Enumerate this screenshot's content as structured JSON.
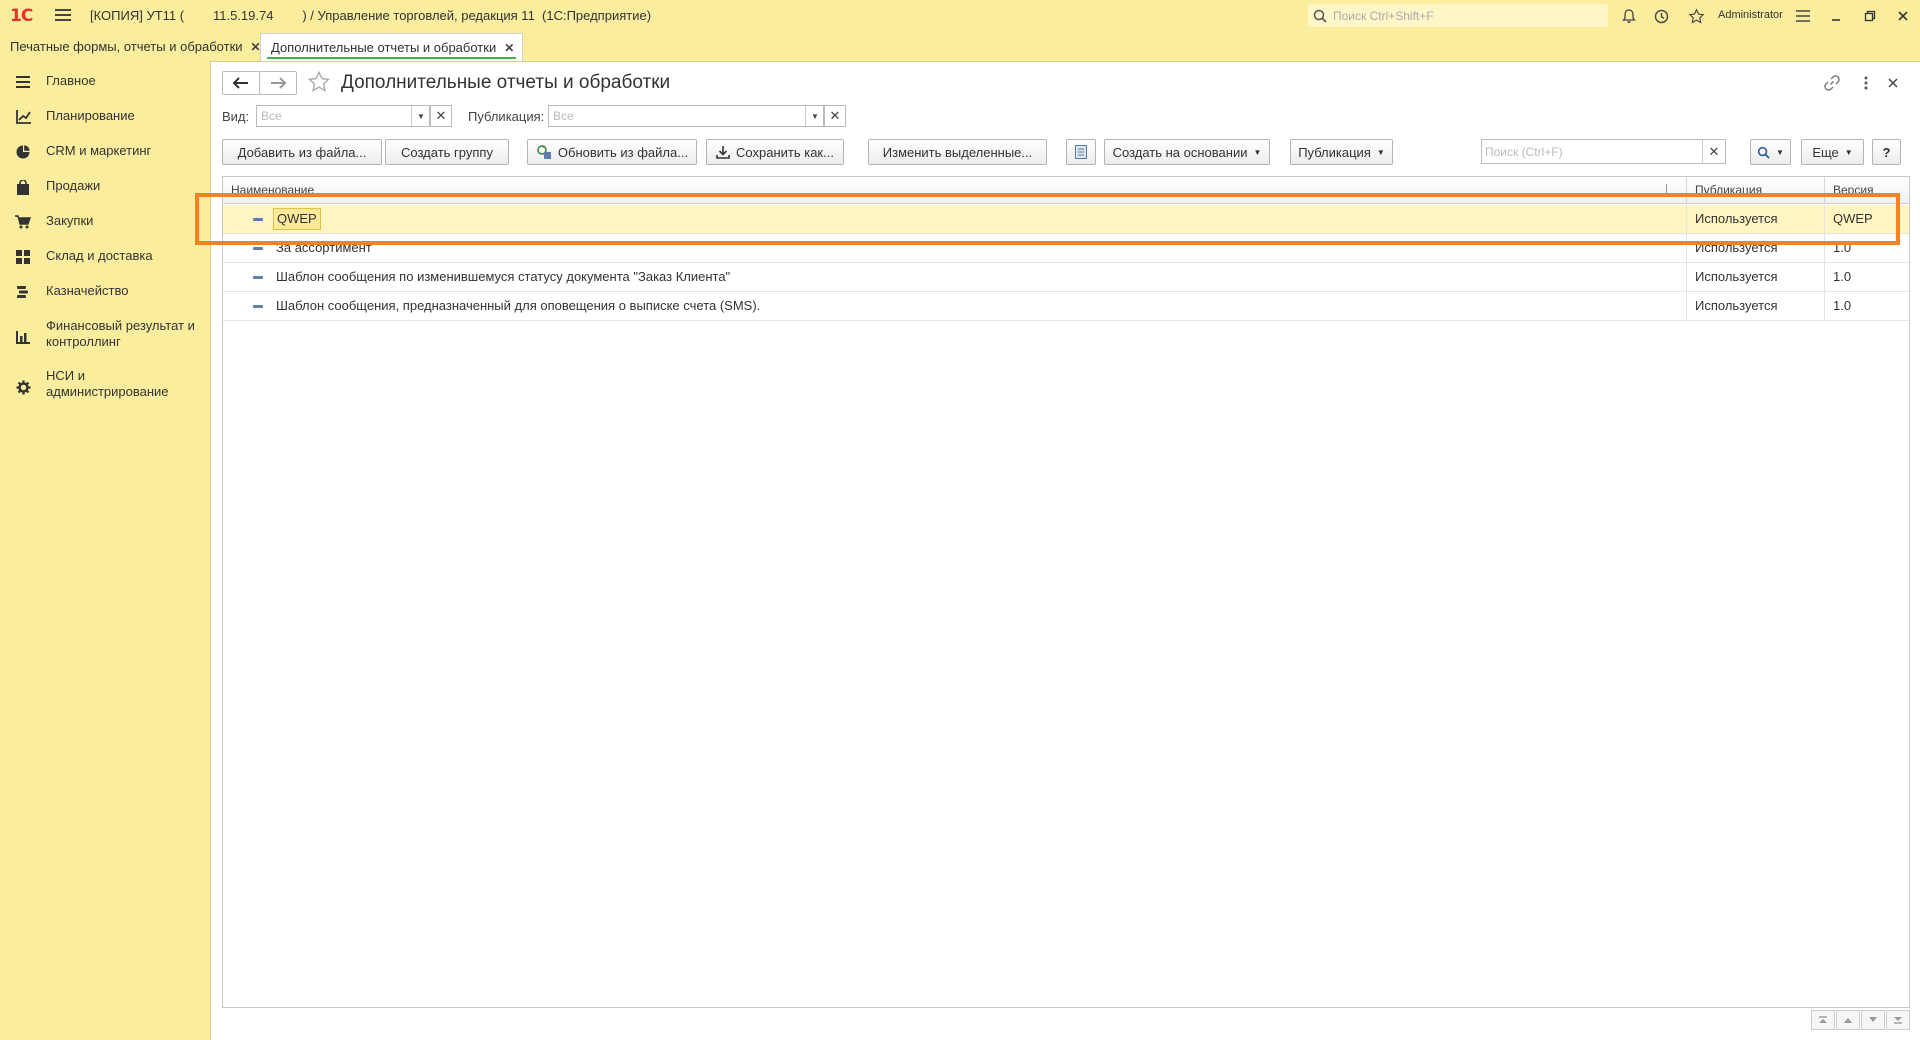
{
  "titlebar": {
    "logo": "1С",
    "title": "[КОПИЯ] УТ11 (        11.5.19.74        ) / Управление торговлей, редакция 11  (1С:Предприятие)",
    "search_placeholder": "Поиск Ctrl+Shift+F",
    "user": "Administrator",
    "icons": [
      "bell-icon",
      "history-icon",
      "star-icon",
      "settings-menu-icon",
      "minimize-icon",
      "restore-icon",
      "close-icon"
    ]
  },
  "tabs": [
    {
      "label": "Печатные формы, отчеты и обработки",
      "active": false
    },
    {
      "label": "Дополнительные отчеты и обработки",
      "active": true
    }
  ],
  "sidebar": {
    "items": [
      {
        "label": "Главное",
        "icon": "menu-lines-icon"
      },
      {
        "label": "Планирование",
        "icon": "planning-chart-icon"
      },
      {
        "label": "CRM и маркетинг",
        "icon": "pie-chart-icon"
      },
      {
        "label": "Продажи",
        "icon": "shopping-bag-icon"
      },
      {
        "label": "Закупки",
        "icon": "cart-icon"
      },
      {
        "label": "Склад и доставка",
        "icon": "warehouse-grid-icon"
      },
      {
        "label": "Казначейство",
        "icon": "coins-icon"
      },
      {
        "label": "Финансовый результат и контроллинг",
        "icon": "bar-chart-icon"
      },
      {
        "label": "НСИ и администрирование",
        "icon": "gear-icon"
      }
    ]
  },
  "page": {
    "title": "Дополнительные отчеты и обработки"
  },
  "filters": {
    "vid_label": "Вид:",
    "vid_placeholder": "Все",
    "pub_label": "Публикация:",
    "pub_placeholder": "Все"
  },
  "toolbar": {
    "add_from_file": "Добавить из файла...",
    "create_group": "Создать группу",
    "update_from_file": "Обновить из файла...",
    "save_as": "Сохранить как...",
    "edit_selected": "Изменить выделенные...",
    "create_based_on": "Создать на основании",
    "publication": "Публикация",
    "search_placeholder": "Поиск (Ctrl+F)",
    "more": "Еще",
    "help": "?"
  },
  "table": {
    "columns": [
      "Наименование",
      "Публикация",
      "Версия"
    ],
    "rows": [
      {
        "name": "QWEP",
        "publication": "Используется",
        "version": "QWEP",
        "selected": true
      },
      {
        "name": "За ассортимент",
        "publication": "Используется",
        "version": "1.0",
        "selected": false
      },
      {
        "name": "Шаблон сообщения по изменившемуся статусу документа \"Заказ Клиента\"",
        "publication": "Используется",
        "version": "1.0",
        "selected": false
      },
      {
        "name": "Шаблон сообщения, предназначенный для оповещения о выписке счета (SMS).",
        "publication": "Используется",
        "version": "1.0",
        "selected": false
      }
    ]
  },
  "colors": {
    "panel_bg": "#fbed9e",
    "highlight": "#f58220",
    "selected_row": "#fff5c2",
    "active_tab_underline": "#47b449"
  }
}
